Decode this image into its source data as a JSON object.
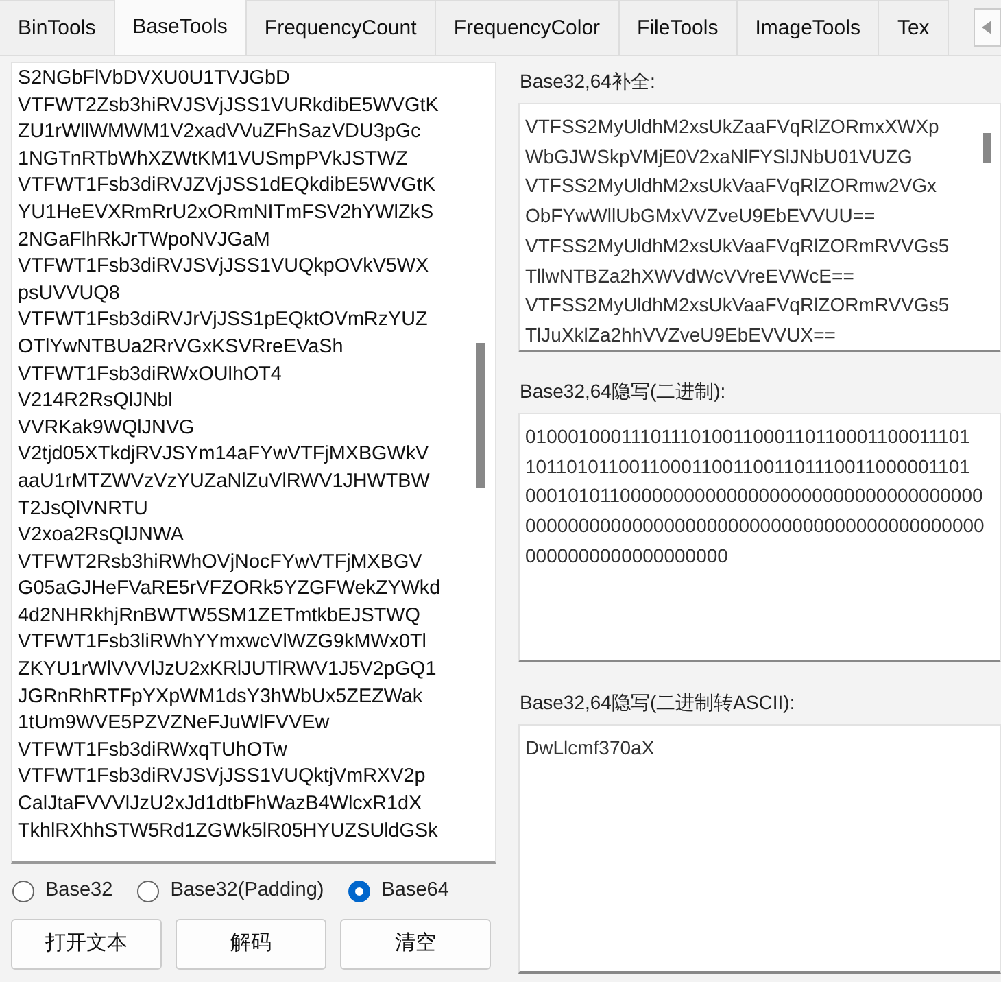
{
  "tabs": [
    {
      "label": "BinTools",
      "selected": false
    },
    {
      "label": "BaseTools",
      "selected": true
    },
    {
      "label": "FrequencyCount",
      "selected": false
    },
    {
      "label": "FrequencyColor",
      "selected": false
    },
    {
      "label": "FileTools",
      "selected": false
    },
    {
      "label": "ImageTools",
      "selected": false
    },
    {
      "label": "Tex",
      "selected": false
    }
  ],
  "input_text": {
    "lines": [
      "S2NGbFlVbDVXU0U1TVJGbD",
      "VTFWT2Zsb3hiRVJSVjJSS1VURkdibE5WVGtK",
      "ZU1rWllWMWM1V2xadVVuZFhSazVDU3pGc",
      "1NGTnRTbWhXZWtKM1VUSmpPVkJSTWZ",
      "VTFWT1Fsb3diRVJZVjJSS1dEQkdibE5WVGtK",
      "YU1HeEVXRmRrU2xORmNITmFSV2hYWlZkS",
      "2NGaFlhRkJrTWpoNVJGaM",
      "VTFWT1Fsb3diRVJSVjJSS1VUQkpOVkV5WX",
      "psUVVUQ8",
      "VTFWT1Fsb3diRVJrVjJSS1pEQktOVmRzYUZ",
      "OTlYwNTBUa2RrVGxKSVRreEVaSh",
      "VTFWT1Fsb3diRWxOUlhOT4",
      "V214R2RsQlJNbl",
      "VVRKak9WQlJNVG",
      "V2tjd05XTkdjRVJSYm14aFYwVTFjMXBGWkV",
      "aaU1rMTZWVzVzYUZaNlZuVlRWV1JHWTBW",
      "T2JsQlVNRTU",
      "V2xoa2RsQlJNWA",
      "VTFWT2Rsb3hiRWhOVjNocFYwVTFjMXBGV",
      "G05aGJHeFVaRE5rVFZORk5YZGFWekZYWkd",
      "4d2NHRkhjRnBWTW5SM1ZETmtkbEJSTWQ",
      "VTFWT1Fsb3liRWhYYmxwcVlWZG9kMWx0Tl",
      "ZKYU1rWlVVVlJzU2xKRlJUTlRWV1J5V2pGQ1",
      "JGRnRhRTFpYXpWM1dsY3hWbUx5ZEZWak",
      "1tUm9WVE5PZVZNeFJuWlFVVEw",
      "VTFWT1Fsb3diRWxqTUhOTw",
      "VTFWT1Fsb3diRVJSVjJSS1VUQktjVmRXV2p",
      "CalJtaFVVVlJzU2xJd1dtbFhWazB4WlcxR1dX",
      "TkhlRXhhSTW5Rd1ZGWk5lR05HYUZSUldGSk"
    ]
  },
  "encodings": [
    {
      "label": "Base32",
      "selected": false
    },
    {
      "label": "Base32(Padding)",
      "selected": false
    },
    {
      "label": "Base64",
      "selected": true
    }
  ],
  "buttons": [
    "打开文本",
    "解码",
    "清空"
  ],
  "outputs": [
    {
      "label": "Base32,64补全:",
      "lines": [
        "VTFSS2MyUldhM2xsUkZaaFVqRlZORmxXWXp",
        "WbGJWSkpVMjE0V2xaNlFYSlJNbU01VUZG",
        "VTFSS2MyUldhM2xsUkVaaFVqRlZORmw2VGx",
        "ObFYwWllUbGMxVVZveU9EbEVVUU==",
        "VTFSS2MyUldhM2xsUkVaaFVqRlZORmRVVGs5",
        "TllwNTBZa2hXWVdWcVVreEVWcE==",
        "VTFSS2MyUldhM2xsUkVaaFVqRlZORmRVVGs5",
        "TlJuXklZa2hhVVZveU9EbEVVUX=="
      ]
    },
    {
      "label": "Base32,64隐写(二进制):",
      "lines": [
        "0100010001110111010011000110110001100011101",
        "1011010110011000110011001101110011000001101",
        "0001010110000000000000000000000000000000000",
        "0000000000000000000000000000000000000000000",
        "0000000000000000000"
      ]
    },
    {
      "label": "Base32,64隐写(二进制转ASCII):",
      "lines": [
        "DwLlcmf370aX"
      ]
    }
  ]
}
